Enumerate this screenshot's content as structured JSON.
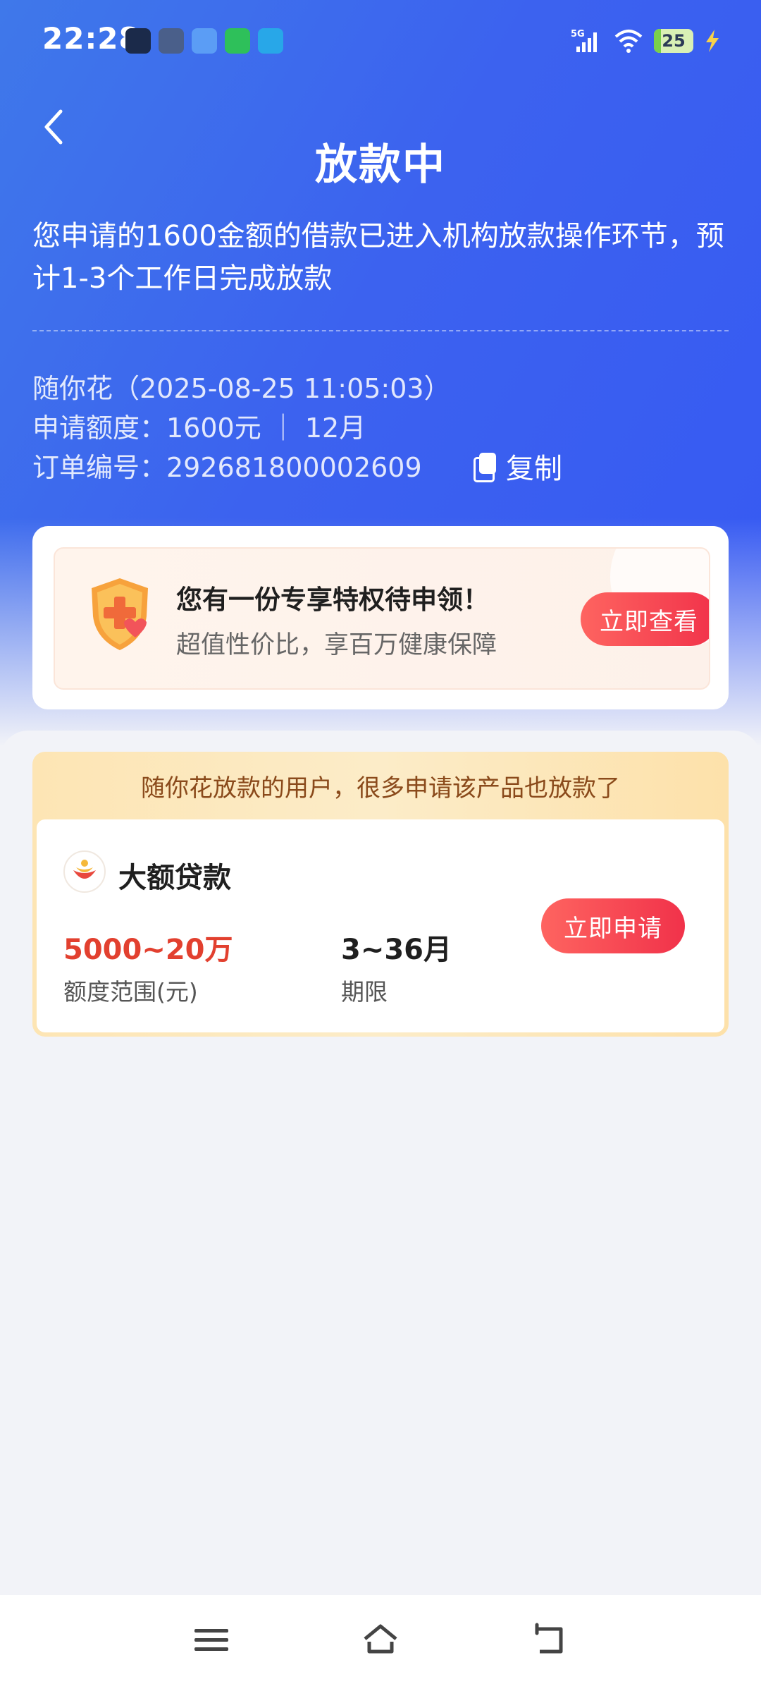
{
  "status_bar": {
    "time": "22:28",
    "network": "5G",
    "battery": "25",
    "icons": [
      "app-icon-1",
      "android-icon",
      "app-icon-3",
      "phone-icon",
      "app-icon-5"
    ]
  },
  "header": {
    "title": "放款中",
    "description": "您申请的1600金额的借款已进入机构放款操作环节，预计1-3个工作日完成放款"
  },
  "order": {
    "product_line": "随你花（2025-08-25 11:05:03）",
    "amount_line": "申请额度：1600元 ｜ 12月",
    "order_line": "订单编号：292681800002609",
    "copy_label": "复制"
  },
  "privilege": {
    "title": "您有一份专享特权待申领！",
    "subtitle": "超值性价比，享百万健康保障",
    "button": "立即查看"
  },
  "recommend": {
    "header": "随你花放款的用户，很多申请该产品也放款了",
    "product": {
      "name": "大额贷款",
      "amount": "5000~20万",
      "amount_label": "额度范围(元)",
      "term": "3~36月",
      "term_label": "期限",
      "button": "立即申请"
    }
  },
  "colors": {
    "header_blue": "#3c62ef",
    "accent_red": "#f1324a",
    "amount_red": "#e2402f",
    "banner_gold": "#fde5b4"
  }
}
